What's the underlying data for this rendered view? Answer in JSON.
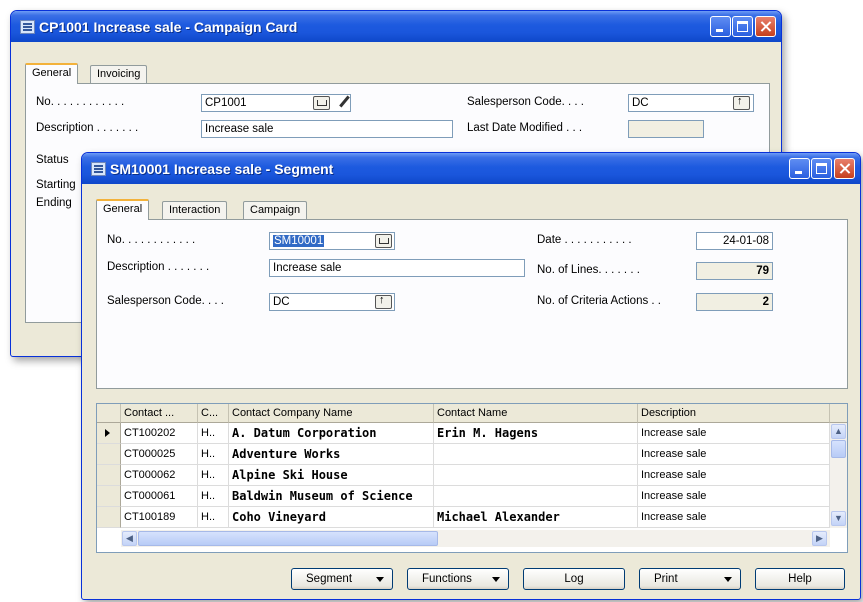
{
  "campaign_window": {
    "title": "CP1001 Increase sale - Campaign Card",
    "tabs": [
      "General",
      "Invoicing"
    ],
    "no_label": "No. . . . . . . . . . . .",
    "no_value": "CP1001",
    "description_label": "Description . . . . . . .",
    "description_value": "Increase sale",
    "status_label": "Status",
    "starting_label": "Starting",
    "ending_label": "Ending",
    "salesperson_label": "Salesperson Code. . . .",
    "salesperson_value": "DC",
    "last_modified_label": "Last Date Modified . . .",
    "last_modified_value": ""
  },
  "segment_window": {
    "title": "SM10001 Increase sale - Segment",
    "tabs": [
      "General",
      "Interaction",
      "Campaign"
    ],
    "no_label": "No. . . . . . . . . . . .",
    "no_value": "SM10001",
    "description_label": "Description . . . . . . .",
    "description_value": "Increase sale",
    "salesperson_label": "Salesperson Code. . . .",
    "salesperson_value": "DC",
    "date_label": "Date . . . . . . . . . . .",
    "date_value": "24-01-08",
    "lines_label": "No. of Lines. . . . . . .",
    "lines_value": "79",
    "criteria_label": "No. of Criteria Actions . .",
    "criteria_value": "2"
  },
  "grid": {
    "columns": [
      "Contact ...",
      "C...",
      "Contact Company Name",
      "Contact Name",
      "Description"
    ],
    "rows": [
      {
        "no": "CT100202",
        "c": "H..",
        "company": "A. Datum Corporation",
        "name": "Erin M. Hagens",
        "description": "Increase sale"
      },
      {
        "no": "CT000025",
        "c": "H..",
        "company": "Adventure Works",
        "name": "",
        "description": "Increase sale"
      },
      {
        "no": "CT000062",
        "c": "H..",
        "company": "Alpine Ski House",
        "name": "",
        "description": "Increase sale"
      },
      {
        "no": "CT000061",
        "c": "H..",
        "company": "Baldwin Museum of Science",
        "name": "",
        "description": "Increase sale"
      },
      {
        "no": "CT100189",
        "c": "H..",
        "company": "Coho Vineyard",
        "name": "Michael Alexander",
        "description": "Increase sale"
      }
    ]
  },
  "buttons": {
    "segment": "Segment",
    "functions": "Functions",
    "log": "Log",
    "print": "Print",
    "help": "Help"
  },
  "icons": [
    "window-icon",
    "minimize-icon",
    "maximize-icon",
    "close-icon",
    "lookup-icon",
    "pencil-icon",
    "dropdown-arrow-icon",
    "row-pointer-icon"
  ]
}
